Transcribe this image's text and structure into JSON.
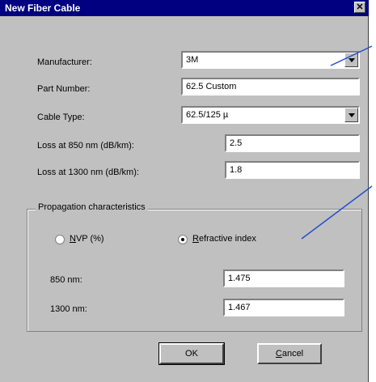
{
  "dialog": {
    "title": "New Fiber Cable",
    "close_glyph": "✕"
  },
  "form": {
    "manufacturer": {
      "label": "Manufacturer:",
      "value": "3M"
    },
    "part_number": {
      "label": "Part Number:",
      "value": "62.5 Custom"
    },
    "cable_type": {
      "label": "Cable Type:",
      "value": "62.5/125 µ"
    },
    "loss_850": {
      "label": "Loss at 850 nm (dB/km):",
      "value": "2.5"
    },
    "loss_1300": {
      "label": "Loss at 1300 nm (dB/km):",
      "value": "1.8"
    }
  },
  "propagation": {
    "group_label": "Propagation characteristics",
    "nvp": {
      "label": "NVP (%)",
      "selected": false
    },
    "refractive": {
      "label": "Refractive index",
      "selected": true
    },
    "nm850": {
      "label": "850 nm:",
      "value": "1.475"
    },
    "nm1300": {
      "label": "1300 nm:",
      "value": "1.467"
    }
  },
  "buttons": {
    "ok": "OK",
    "cancel": "Cancel"
  },
  "colors": {
    "titlebar": "#000080",
    "face": "#c0c0c0",
    "annotation_line": "#1f4fd0"
  }
}
